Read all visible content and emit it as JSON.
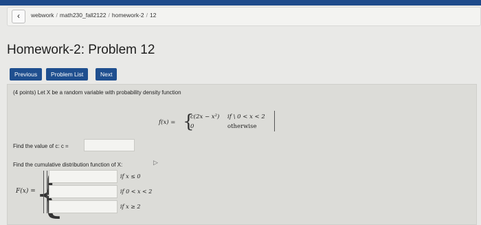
{
  "breadcrumb": {
    "back_icon": "chevron-left-icon",
    "items": [
      "webwork",
      "math230_fall2122",
      "homework-2",
      "12"
    ]
  },
  "page_title": "Homework-2: Problem 12",
  "nav": {
    "previous": "Previous",
    "problem_list": "Problem List",
    "next": "Next"
  },
  "problem": {
    "intro": "(4 points) Let X be a random variable with probability density function",
    "pdf_lhs": "f(x) =",
    "pdf_case1_expr": "c(2x − x²)",
    "pdf_case1_cond": "if \\ 0 < x < 2",
    "pdf_case2_expr": "0",
    "pdf_case2_cond": "otherwise",
    "find_c_label": "Find the value of c: c =",
    "c_input_value": "",
    "cdf_prompt": "Find the cumulative distribution function of X:",
    "cdf_lhs": "F(x) =",
    "cdf_rows": [
      {
        "value": "",
        "condition": "if x ≤ 0"
      },
      {
        "value": "",
        "condition": "if 0 < x < 2"
      },
      {
        "value": "",
        "condition": "if x ≥ 2"
      }
    ]
  },
  "colors": {
    "nav_button": "#1f4f8f",
    "top_bar": "#1e4a8a",
    "panel": "#dcdcd8"
  }
}
